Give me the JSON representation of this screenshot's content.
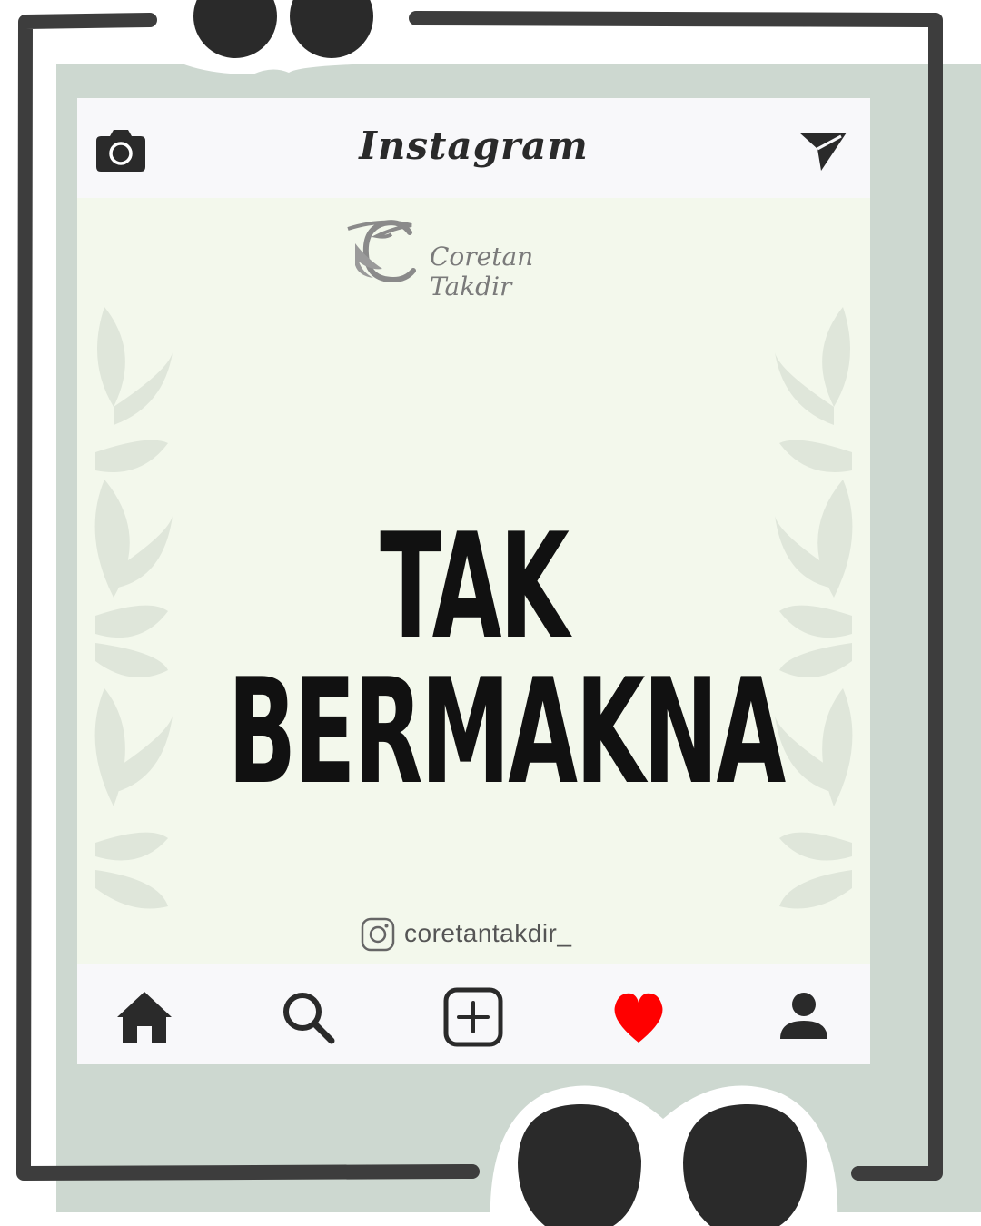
{
  "app": {
    "title": "Instagram"
  },
  "header": {
    "left_icon": "camera-icon",
    "right_icon": "send-icon"
  },
  "post": {
    "brand": "Coretan Takdir",
    "brand_icon": "feather-c-logo",
    "headline": "TAK BERMAKNA",
    "handle": "coretantakdir_",
    "handle_icon": "instagram-glyph-icon"
  },
  "bottom_nav": {
    "items": [
      {
        "icon": "home-icon"
      },
      {
        "icon": "search-icon"
      },
      {
        "icon": "add-post-icon"
      },
      {
        "icon": "heart-icon"
      },
      {
        "icon": "profile-icon"
      }
    ]
  },
  "colors": {
    "frame": "#3d3d3d",
    "backdrop": "#cdd8d0",
    "screen": "#f3f8ec",
    "bar": "#f8f8fa",
    "heart": "#ff0000",
    "ink": "#2a2a2a"
  }
}
